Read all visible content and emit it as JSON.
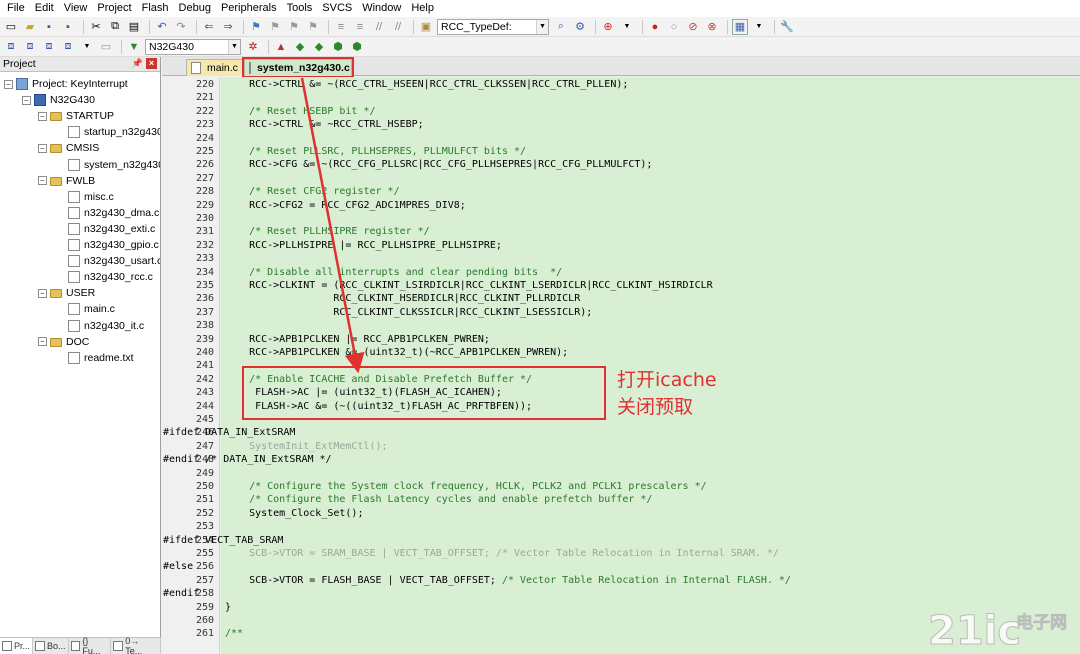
{
  "menu": [
    "File",
    "Edit",
    "View",
    "Project",
    "Flash",
    "Debug",
    "Peripherals",
    "Tools",
    "SVCS",
    "Window",
    "Help"
  ],
  "toolbar": {
    "search_combo": "RCC_TypeDef:",
    "target_combo": "N32G430"
  },
  "project_panel": {
    "title": "Project",
    "tree": [
      {
        "label": "Project: KeyInterrupt",
        "level": 0,
        "kind": "project"
      },
      {
        "label": "N32G430",
        "level": 1,
        "kind": "target"
      },
      {
        "label": "STARTUP",
        "level": 2,
        "kind": "folder"
      },
      {
        "label": "startup_n32g430.",
        "level": 3,
        "kind": "file"
      },
      {
        "label": "CMSIS",
        "level": 2,
        "kind": "folder"
      },
      {
        "label": "system_n32g430.",
        "level": 3,
        "kind": "file"
      },
      {
        "label": "FWLB",
        "level": 2,
        "kind": "folder"
      },
      {
        "label": "misc.c",
        "level": 3,
        "kind": "file"
      },
      {
        "label": "n32g430_dma.c",
        "level": 3,
        "kind": "file"
      },
      {
        "label": "n32g430_exti.c",
        "level": 3,
        "kind": "file"
      },
      {
        "label": "n32g430_gpio.c",
        "level": 3,
        "kind": "file"
      },
      {
        "label": "n32g430_usart.c",
        "level": 3,
        "kind": "file"
      },
      {
        "label": "n32g430_rcc.c",
        "level": 3,
        "kind": "file"
      },
      {
        "label": "USER",
        "level": 2,
        "kind": "folder"
      },
      {
        "label": "main.c",
        "level": 3,
        "kind": "file"
      },
      {
        "label": "n32g430_it.c",
        "level": 3,
        "kind": "file"
      },
      {
        "label": "DOC",
        "level": 2,
        "kind": "folder"
      },
      {
        "label": "readme.txt",
        "level": 3,
        "kind": "file"
      }
    ],
    "bottom_tabs": [
      "Pr...",
      "Bo...",
      "{} Fu...",
      "0→ Te..."
    ]
  },
  "editor": {
    "tabs": [
      {
        "label": "main.c"
      },
      {
        "label": "system_n32g430.c"
      }
    ],
    "lines": [
      {
        "n": "220",
        "t": "    RCC->CTRL &= ~(RCC_CTRL_HSEEN|RCC_CTRL_CLKSSEN|RCC_CTRL_PLLEN);",
        "s": "code"
      },
      {
        "n": "221",
        "t": "",
        "s": "code"
      },
      {
        "n": "222",
        "t": "    /* Reset HSEBP bit */",
        "s": "comment"
      },
      {
        "n": "223",
        "t": "    RCC->CTRL &= ~RCC_CTRL_HSEBP;",
        "s": "code"
      },
      {
        "n": "224",
        "t": "",
        "s": "code"
      },
      {
        "n": "225",
        "t": "    /* Reset PLLSRC, PLLHSEPRES, PLLMULFCT bits */",
        "s": "comment"
      },
      {
        "n": "226",
        "t": "    RCC->CFG &= ~(RCC_CFG_PLLSRC|RCC_CFG_PLLHSEPRES|RCC_CFG_PLLMULFCT);",
        "s": "code"
      },
      {
        "n": "227",
        "t": "",
        "s": "code"
      },
      {
        "n": "228",
        "t": "    /* Reset CFG2 register */",
        "s": "comment"
      },
      {
        "n": "229",
        "t": "    RCC->CFG2 = RCC_CFG2_ADC1MPRES_DIV8;",
        "s": "code"
      },
      {
        "n": "230",
        "t": "",
        "s": "code"
      },
      {
        "n": "231",
        "t": "    /* Reset PLLHSIPRE register */",
        "s": "comment"
      },
      {
        "n": "232",
        "t": "    RCC->PLLHSIPRE |= RCC_PLLHSIPRE_PLLHSIPRE;",
        "s": "code"
      },
      {
        "n": "233",
        "t": "",
        "s": "code"
      },
      {
        "n": "234",
        "t": "    /* Disable all interrupts and clear pending bits  */",
        "s": "comment"
      },
      {
        "n": "235",
        "t": "    RCC->CLKINT = (RCC_CLKINT_LSIRDICLR|RCC_CLKINT_LSERDICLR|RCC_CLKINT_HSIRDICLR",
        "s": "code"
      },
      {
        "n": "236",
        "t": "                  RCC_CLKINT_HSERDICLR|RCC_CLKINT_PLLRDICLR",
        "s": "code"
      },
      {
        "n": "237",
        "t": "                  RCC_CLKINT_CLKSSICLR|RCC_CLKINT_LSESSICLR);",
        "s": "code"
      },
      {
        "n": "238",
        "t": "",
        "s": "code"
      },
      {
        "n": "239",
        "t": "    RCC->APB1PCLKEN |= RCC_APB1PCLKEN_PWREN;",
        "s": "code"
      },
      {
        "n": "240",
        "t": "    RCC->APB1PCLKEN &= (uint32_t)(~RCC_APB1PCLKEN_PWREN);",
        "s": "code"
      },
      {
        "n": "241",
        "t": "",
        "s": "code"
      },
      {
        "n": "242",
        "t": "    /* Enable ICACHE and Disable Prefetch Buffer */",
        "s": "comment"
      },
      {
        "n": "243",
        "t": "     FLASH->AC |= (uint32_t)(FLASH_AC_ICAHEN);",
        "s": "code"
      },
      {
        "n": "244",
        "t": "     FLASH->AC &= (~((uint32_t)FLASH_AC_PRFTBFEN));",
        "s": "code"
      },
      {
        "n": "245",
        "t": "",
        "s": "code"
      },
      {
        "n": "246",
        "t": "#ifdef DATA_IN_ExtSRAM",
        "s": "pre"
      },
      {
        "n": "247",
        "t": "    SystemInit_ExtMemCtl();",
        "s": "gray"
      },
      {
        "n": "248",
        "t": "#endif /* DATA_IN_ExtSRAM */",
        "s": "premix"
      },
      {
        "n": "249",
        "t": "",
        "s": "code"
      },
      {
        "n": "250",
        "t": "    /* Configure the System clock frequency, HCLK, PCLK2 and PCLK1 prescalers */",
        "s": "comment"
      },
      {
        "n": "251",
        "t": "    /* Configure the Flash Latency cycles and enable prefetch buffer */",
        "s": "comment"
      },
      {
        "n": "252",
        "t": "    System_Clock_Set();",
        "s": "code"
      },
      {
        "n": "253",
        "t": "",
        "s": "code"
      },
      {
        "n": "254",
        "t": "#ifdef VECT_TAB_SRAM",
        "s": "pre"
      },
      {
        "n": "255",
        "t": "    SCB->VTOR = SRAM_BASE | VECT_TAB_OFFSET; /* Vector Table Relocation in Internal SRAM. */",
        "s": "gray"
      },
      {
        "n": "256",
        "t": "#else",
        "s": "pre"
      },
      {
        "n": "257",
        "t": "    SCB->VTOR = FLASH_BASE | VECT_TAB_OFFSET; ",
        "tail": "/* Vector Table Relocation in Internal FLASH. */",
        "s": "codemix"
      },
      {
        "n": "258",
        "t": "#endif",
        "s": "pre"
      },
      {
        "n": "259",
        "t": "}",
        "s": "code"
      },
      {
        "n": "260",
        "t": "",
        "s": "code"
      },
      {
        "n": "261",
        "t": "/**",
        "s": "comment"
      }
    ]
  },
  "annotation": {
    "line1": "打开icache",
    "line2": "关闭预取"
  },
  "watermark": {
    "logo": "21ic",
    "cn": "电子网"
  },
  "colors": {
    "code_bg": "#d9efd4",
    "annotation_red": "#e03030",
    "comment_green": "#2a7a2a"
  }
}
